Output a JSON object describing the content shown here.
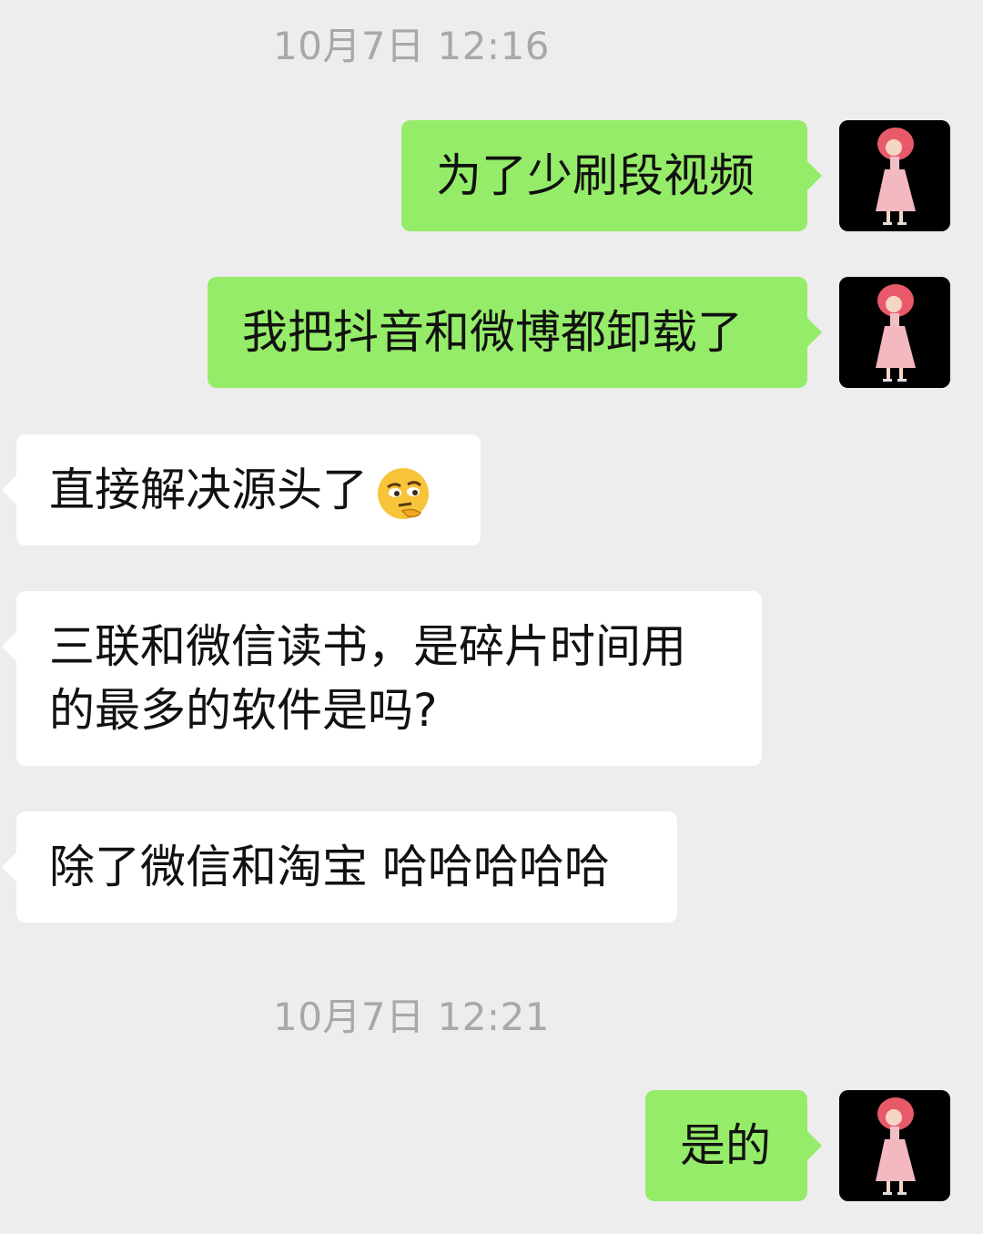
{
  "chat": {
    "timestamps": [
      "10月7日 12:16",
      "10月7日 12:21"
    ],
    "messages": [
      {
        "side": "me",
        "text": "为了少刷段视频"
      },
      {
        "side": "me",
        "text": "我把抖音和微博都卸载了"
      },
      {
        "side": "them",
        "text": "直接解决源头了",
        "emoji": "thinking-face-emoji"
      },
      {
        "side": "them",
        "text_line1": "三联和微信读书，是碎片时间用",
        "text_line2": "的最多的软件是吗?"
      },
      {
        "side": "them",
        "text": "除了微信和淘宝 哈哈哈哈哈"
      },
      {
        "side": "me",
        "text": "是的"
      }
    ],
    "avatar_icon": "avatar-girl-pink-hair-icon",
    "colors": {
      "background": "#ededed",
      "my_bubble": "#95ec69",
      "their_bubble": "#ffffff",
      "timestamp": "#a8a8a8"
    }
  }
}
